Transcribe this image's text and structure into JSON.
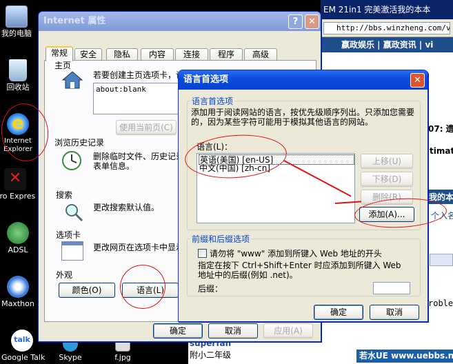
{
  "desktop": {
    "icons": [
      {
        "label": "我的电脑",
        "icon": "computer-icon"
      },
      {
        "label": "回收站",
        "icon": "recycle-bin-icon"
      },
      {
        "label": "Internet Explorer",
        "icon": "internet-explorer-icon"
      },
      {
        "label": "ero Expres",
        "icon": "nero-icon"
      },
      {
        "label": "ADSL",
        "icon": "network-icon"
      },
      {
        "label": "Maxthon",
        "icon": "maxthon-icon"
      },
      {
        "label": "Google Talk",
        "icon": "gtalk-icon"
      },
      {
        "label": "Skype",
        "icon": "skype-icon"
      },
      {
        "label": "f.jpg",
        "icon": "image-file-icon"
      }
    ]
  },
  "browser": {
    "title": "EM 21in1 完美激活我的本本",
    "address": "http://bbs.winzheng.com/vi",
    "nav": "嬴政娱乐 | 嬴政资讯 | vi",
    "frag1": "07: 遗",
    "frag2": "timate",
    "frag3": "我的本",
    "frag4": "个入名",
    "frag5": "roble",
    "user_name": "superfan",
    "user_rank": "附小二年级"
  },
  "internet_options": {
    "title": "Internet 属性",
    "help": "?",
    "close": "✕",
    "tabs": [
      "常规",
      "安全",
      "隐私",
      "内容",
      "连接",
      "程序",
      "高级"
    ],
    "homepage_label": "主页",
    "homepage_text": "若要创建主页选项卡，请",
    "homepage_value": "about:blank",
    "use_current_btn": "使用当前页(C)",
    "history_label": "浏览历史记录",
    "history_text1": "删除临时文件、历史记录",
    "history_text2": "表单信息。",
    "search_label": "搜索",
    "search_text": "更改搜索默认值。",
    "tabs_label": "选项卡",
    "tabs_text": "更改网页在选项卡中显示",
    "appearance_label": "外观",
    "colors_btn": "颜色(O)",
    "languages_btn": "语言(L)",
    "ok_btn": "确定",
    "cancel_btn": "取消",
    "apply_btn": "应用(A)"
  },
  "language_dialog": {
    "title": "语言首选项",
    "close": "✕",
    "group1_title": "语言首选项",
    "description": "添加用于阅读网站的语言，按优先级顺序列出。只添加您需要的，因为某些字符可能用于模拟其他语言的网站。",
    "list_label": "语言(L)：",
    "languages": [
      "英语(美国) [en-US]",
      "中文(中国) [zh-cn]"
    ],
    "move_up_btn": "上移(U)",
    "move_down_btn": "下移(D)",
    "remove_btn": "删除(R)",
    "add_btn": "添加(A)...",
    "group2_title": "前缀和后缀选项",
    "checkbox_label": "请勿将 \"www\" 添加到所键入 Web 地址的开头",
    "ctrl_text1": "指定在按下 Ctrl+Shift+Enter 时应添加到所键入 Web",
    "ctrl_text2": "地址中的后缀(例如 .net)。",
    "suffix_label": "后缀：",
    "ok_btn": "确定",
    "cancel_btn": "取消"
  },
  "watermark": "若水UE www.uebbs.net"
}
